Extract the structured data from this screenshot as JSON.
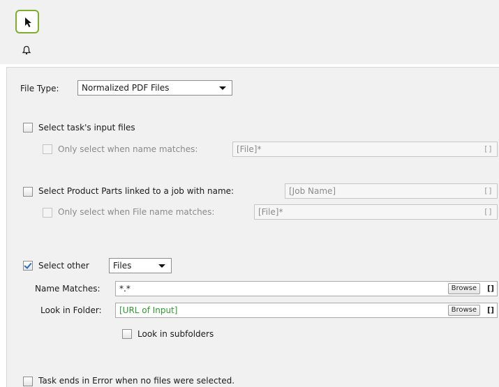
{
  "toolbar": {
    "pointer_icon": "pointer-arrow-icon",
    "bell_icon": "bell-icon"
  },
  "file_type": {
    "label": "File Type:",
    "selected": "Normalized PDF Files"
  },
  "task_input": {
    "label": "Select task's input files",
    "checked": false,
    "name_match_label": "Only select when name matches:",
    "name_match_value": "[File]*",
    "bracket": "[]"
  },
  "product_parts": {
    "label": "Select Product Parts linked to a job with name:",
    "checked": false,
    "job_name_value": "[Job Name]",
    "bracket": "[]",
    "file_match_label": "Only select when File name matches:",
    "file_match_value": "[File]*",
    "bracket2": "[]"
  },
  "select_other": {
    "label": "Select other",
    "checked": true,
    "type_selected": "Files",
    "name_matches_label": "Name Matches:",
    "name_matches_value": "*.*",
    "look_in_folder_label": "Look in Folder:",
    "look_in_folder_value": "[URL of Input]",
    "browse_label": "Browse",
    "bracket": "[]",
    "subfolders_label": "Look in subfolders",
    "subfolders_checked": false
  },
  "error_option": {
    "label": "Task ends in Error when no files were selected.",
    "checked": false
  },
  "colors": {
    "accent_green": "#7fae2e",
    "value_green": "#2f9a2f",
    "check_blue": "#2a6cc6"
  }
}
